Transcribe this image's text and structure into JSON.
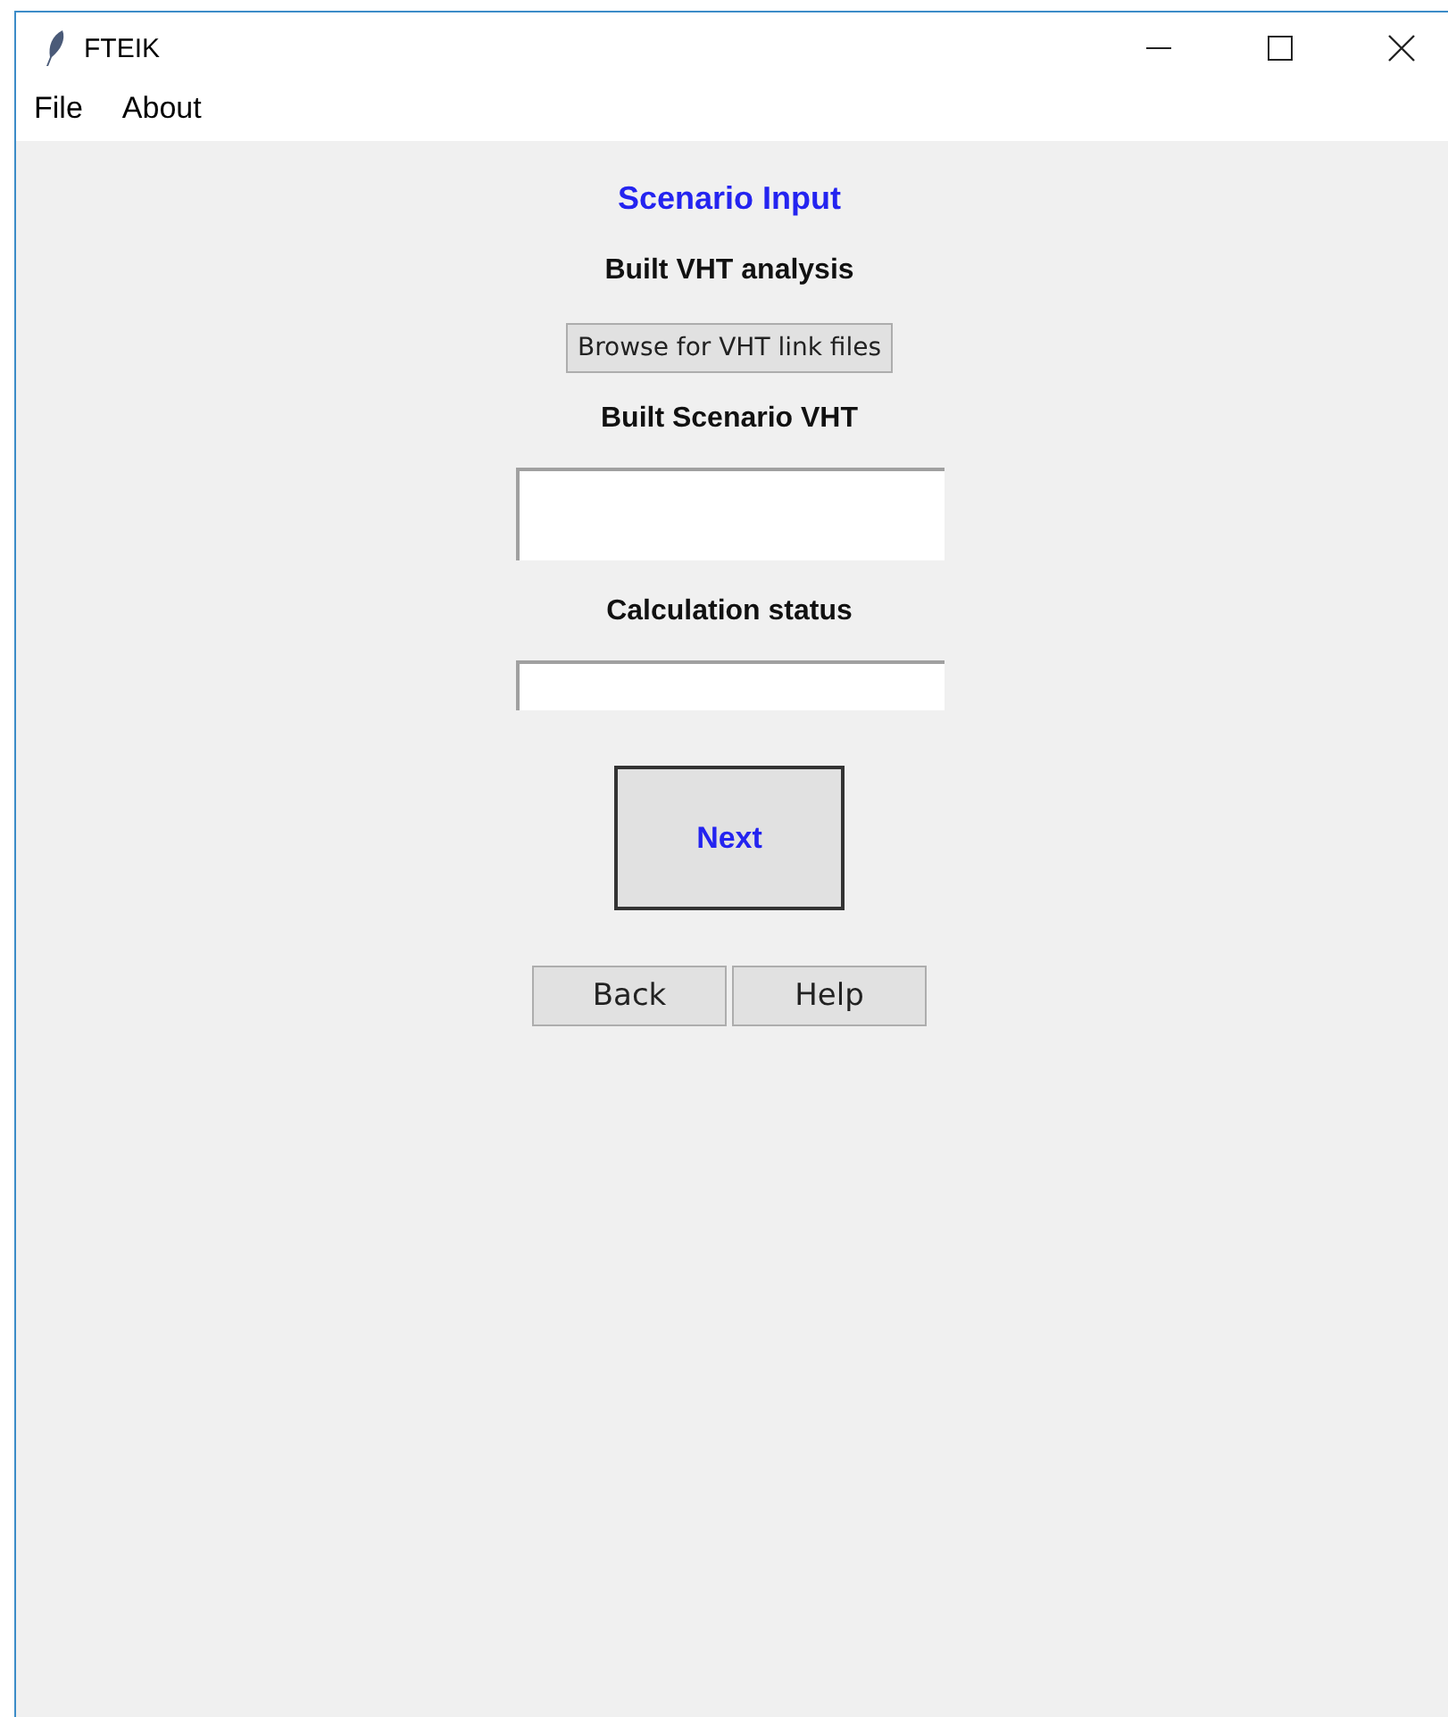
{
  "window": {
    "title": "FTEIK"
  },
  "menu": [
    "File",
    "About"
  ],
  "heading": "Scenario Input",
  "analysis_label": "Built VHT analysis",
  "browse_button": "Browse for VHT link files",
  "vht_label": "Built Scenario VHT",
  "status_label": "Calculation status",
  "next_button": "Next",
  "buttons": [
    "Back",
    "Help"
  ]
}
